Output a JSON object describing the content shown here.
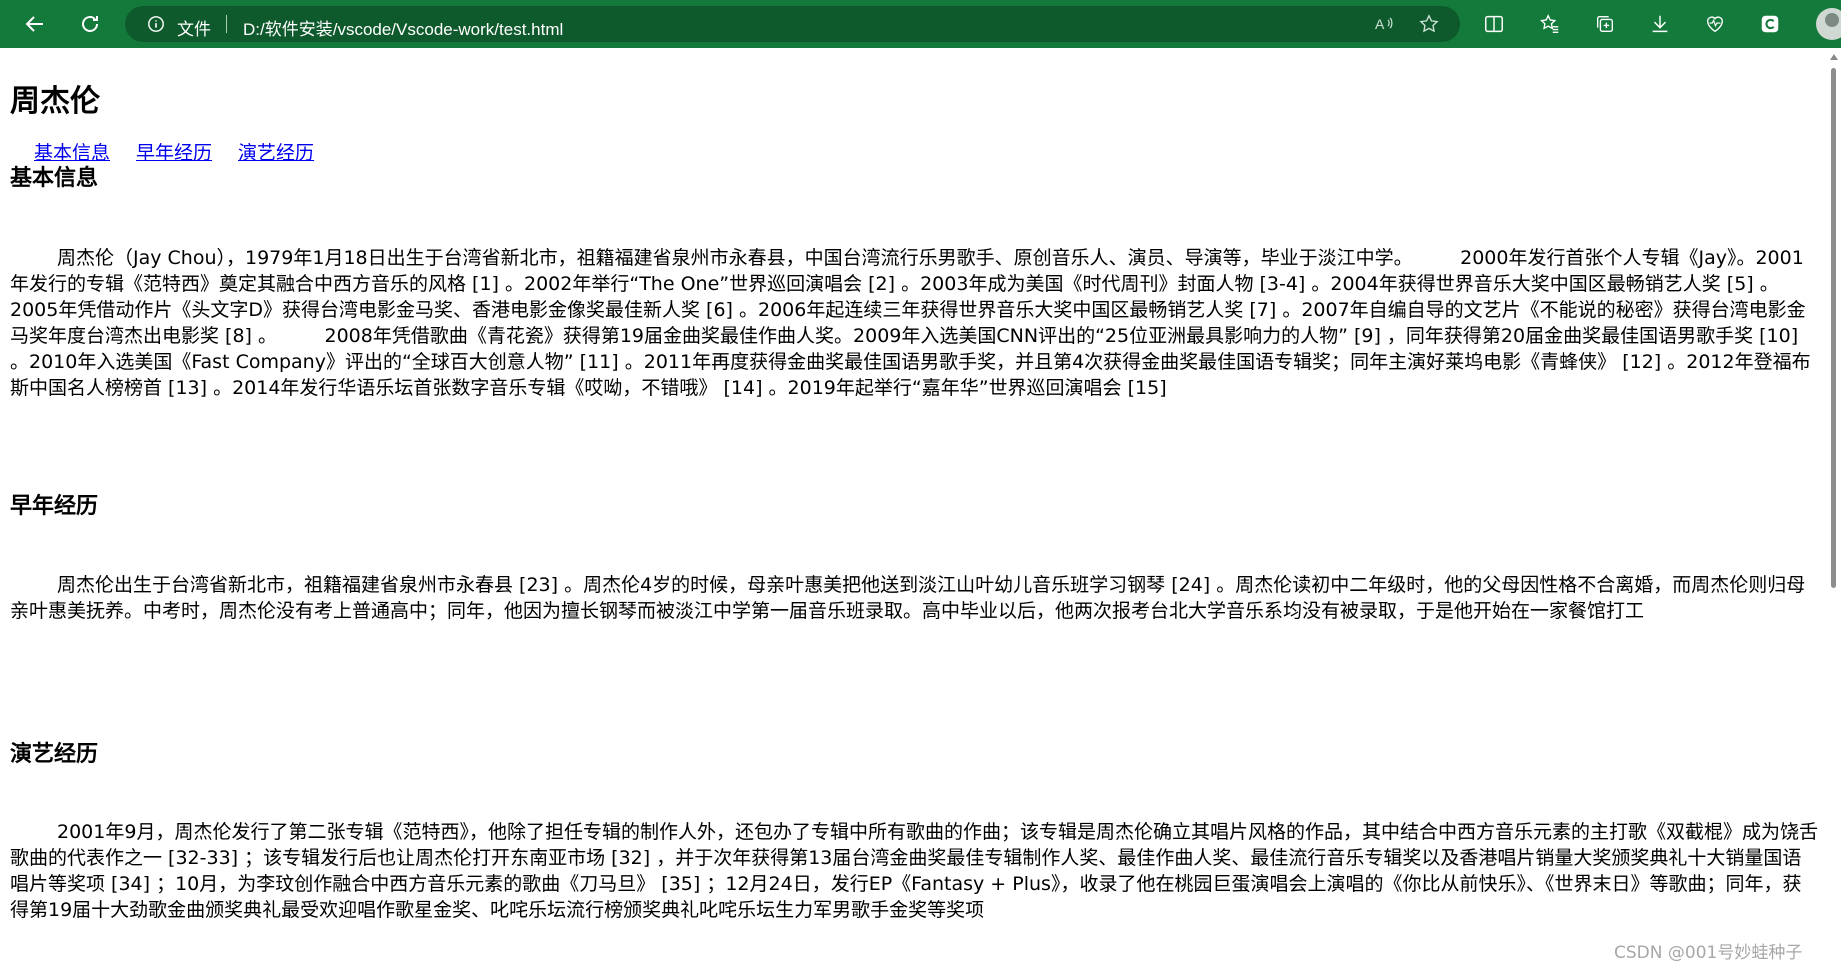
{
  "browser": {
    "file_label": "文件",
    "url": "D:/软件安装/vscode/Vscode-work/test.html",
    "icons": [
      "back-icon",
      "refresh-icon",
      "info-icon",
      "read-aloud-icon",
      "favorite-star-icon",
      "split-screen-icon",
      "favorites-icon",
      "collections-icon",
      "downloads-icon",
      "performance-icon",
      "copilot-icon",
      "avatar"
    ]
  },
  "page": {
    "title": "周杰伦",
    "toc": [
      "基本信息",
      "早年经历",
      "演艺经历"
    ],
    "sections": [
      {
        "heading": "基本信息",
        "text": "周杰伦（Jay Chou），1979年1月18日出生于台湾省新北市，祖籍福建省泉州市永春县，中国台湾流行乐男歌手、原创音乐人、演员、导演等，毕业于淡江中学。　　　2000年发行首张个人专辑《Jay》。2001年发行的专辑《范特西》奠定其融合中西方音乐的风格 [1] 。2002年举行“The One”世界巡回演唱会 [2] 。2003年成为美国《时代周刊》封面人物 [3-4] 。2004年获得世界音乐大奖中国区最畅销艺人奖 [5] 。2005年凭借动作片《头文字D》获得台湾电影金马奖、香港电影金像奖最佳新人奖 [6] 。2006年起连续三年获得世界音乐大奖中国区最畅销艺人奖 [7] 。2007年自编自导的文艺片《不能说的秘密》获得台湾电影金马奖年度台湾杰出电影奖 [8] 。　　　2008年凭借歌曲《青花瓷》获得第19届金曲奖最佳作曲人奖。2009年入选美国CNN评出的“25位亚洲最具影响力的人物” [9] ，同年获得第20届金曲奖最佳国语男歌手奖 [10] 。2010年入选美国《Fast Company》评出的“全球百大创意人物” [11] 。2011年再度获得金曲奖最佳国语男歌手奖，并且第4次获得金曲奖最佳国语专辑奖；同年主演好莱坞电影《青蜂侠》 [12] 。2012年登福布斯中国名人榜榜首 [13] 。2014年发行华语乐坛首张数字音乐专辑《哎呦，不错哦》 [14] 。2019年起举行“嘉年华”世界巡回演唱会 [15]"
      },
      {
        "heading": "早年经历",
        "text": "周杰伦出生于台湾省新北市，祖籍福建省泉州市永春县 [23] 。周杰伦4岁的时候，母亲叶惠美把他送到淡江山叶幼儿音乐班学习钢琴 [24] 。周杰伦读初中二年级时，他的父母因性格不合离婚，而周杰伦则归母亲叶惠美抚养。中考时，周杰伦没有考上普通高中；同年，他因为擅长钢琴而被淡江中学第一届音乐班录取。高中毕业以后，他两次报考台北大学音乐系均没有被录取，于是他开始在一家餐馆打工"
      },
      {
        "heading": "演艺经历",
        "text": "2001年9月，周杰伦发行了第二张专辑《范特西》，他除了担任专辑的制作人外，还包办了专辑中所有歌曲的作曲；该专辑是周杰伦确立其唱片风格的作品，其中结合中西方音乐元素的主打歌《双截棍》成为饶舌歌曲的代表作之一 [32-33] ；该专辑发行后也让周杰伦打开东南亚市场 [32] ，并于次年获得第13届台湾金曲奖最佳专辑制作人奖、最佳作曲人奖、最佳流行音乐专辑奖以及香港唱片销量大奖颁奖典礼十大销量国语唱片等奖项 [34] ；10月，为李玟创作融合中西方音乐元素的歌曲《刀马旦》 [35] ；12月24日，发行EP《Fantasy + Plus》，收录了他在桃园巨蛋演唱会上演唱的《你比从前快乐》、《世界末日》等歌曲；同年，获得第19届十大劲歌金曲颁奖典礼最受欢迎唱作歌星金奖、叱咤乐坛流行榜颁奖典礼叱咤乐坛生力军男歌手金奖等奖项"
      }
    ]
  },
  "watermark": "CSDN @001号妙蛙种子"
}
